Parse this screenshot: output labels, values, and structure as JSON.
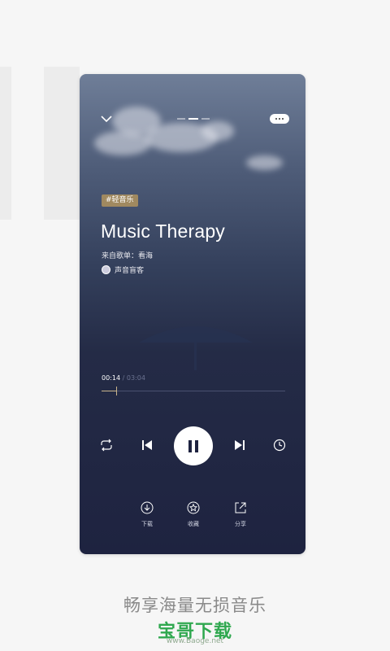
{
  "screen": {
    "pager": {
      "pages": 3,
      "active": 1
    },
    "tag": "#轻音乐",
    "title": "Music Therapy",
    "source": "来自歌单：看海",
    "author": "声音盲客",
    "time": {
      "current": "00:14",
      "separator": "/",
      "total": "03:04"
    },
    "progress": 0.08,
    "icons": {
      "collapse": "chevron-down-icon",
      "more": "more-icon",
      "repeat": "repeat-icon",
      "previous": "previous-icon",
      "pause": "pause-icon",
      "next": "next-icon",
      "timer": "clock-icon"
    },
    "actions": [
      {
        "icon": "download-icon",
        "label": "下载"
      },
      {
        "icon": "star-icon",
        "label": "收藏"
      },
      {
        "icon": "share-icon",
        "label": "分享"
      }
    ],
    "colors": {
      "accent": "#c9b48c",
      "tag_bg": "#a08960",
      "panel_dark": "#1e2340"
    }
  },
  "promo": {
    "caption": "畅享海量无损音乐",
    "brand": "宝哥下载",
    "brand_url": "www.Baoge.net"
  }
}
